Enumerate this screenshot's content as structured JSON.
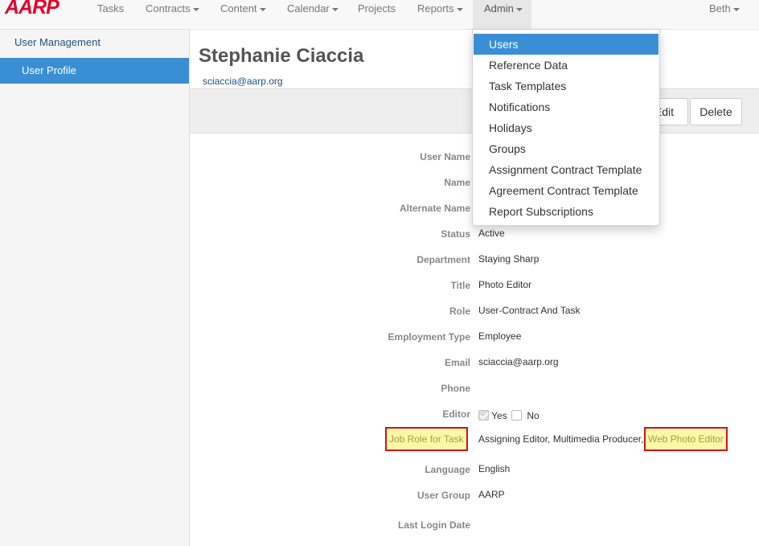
{
  "navbar": {
    "logo": "AARP",
    "items": [
      {
        "label": "Tasks"
      },
      {
        "label": "Contracts"
      },
      {
        "label": "Content"
      },
      {
        "label": "Calendar"
      },
      {
        "label": "Projects"
      },
      {
        "label": "Reports"
      },
      {
        "label": "Admin"
      }
    ],
    "user": "Beth"
  },
  "sidebar": {
    "items": [
      {
        "label": "User Management"
      },
      {
        "label": "User Profile",
        "active": true
      }
    ]
  },
  "profile": {
    "name": "Stephanie Ciaccia",
    "email": "sciaccia@aarp.org"
  },
  "toolbar": {
    "edit_label": "Edit",
    "delete_label": "Delete"
  },
  "fields": {
    "user_name": {
      "label": "User Name",
      "value": ""
    },
    "name": {
      "label": "Name",
      "value": ""
    },
    "alternate_name": {
      "label": "Alternate Name",
      "value": ""
    },
    "status": {
      "label": "Status",
      "value": "Active"
    },
    "department": {
      "label": "Department",
      "value": "Staying Sharp"
    },
    "title": {
      "label": "Title",
      "value": "Photo Editor"
    },
    "role": {
      "label": "Role",
      "value": "User-Contract And Task"
    },
    "employment_type": {
      "label": "Employment Type",
      "value": "Employee"
    },
    "email": {
      "label": "Email",
      "value": "sciaccia@aarp.org"
    },
    "phone": {
      "label": "Phone",
      "value": ""
    },
    "editor": {
      "label": "Editor",
      "yes_label": "Yes",
      "no_label": "No",
      "yes_checked": true,
      "no_checked": false
    },
    "job_role": {
      "label": "Job Role for Task",
      "value": "Assigning Editor, Multimedia Producer,",
      "highlighted_value": "Web Photo Editor"
    },
    "language": {
      "label": "Language",
      "value": "English"
    },
    "user_group": {
      "label": "User Group",
      "value": "AARP"
    },
    "last_login": {
      "label": "Last Login Date",
      "value": ""
    }
  },
  "admin_menu": {
    "items": [
      {
        "label": "Users",
        "active": true
      },
      {
        "label": "Reference Data"
      },
      {
        "label": "Task Templates"
      },
      {
        "label": "Notifications"
      },
      {
        "label": "Holidays"
      },
      {
        "label": "Groups"
      },
      {
        "label": "Assignment Contract Template"
      },
      {
        "label": "Agreement Contract Template"
      },
      {
        "label": "Report Subscriptions"
      }
    ]
  },
  "colors": {
    "brand": "#e4002b",
    "accent": "#3a8fd4",
    "highlight_bg": "#fbf7a9",
    "highlight_border": "#d0121a"
  }
}
